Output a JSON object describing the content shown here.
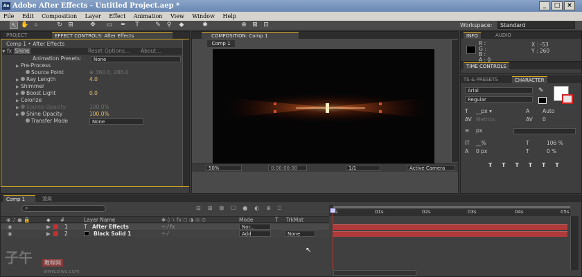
{
  "window": {
    "title": "Adobe After Effects - Untitled Project.aep *",
    "icon_text": "Ae"
  },
  "menu": [
    "File",
    "Edit",
    "Composition",
    "Layer",
    "Effect",
    "Animation",
    "View",
    "Window",
    "Help"
  ],
  "workspace": {
    "label": "Workspace:",
    "value": "Standard"
  },
  "project_panel": {
    "tab_project": "PROJECT",
    "tab_effect": "EFFECT CONTROLS: After Effects"
  },
  "effect_controls": {
    "header": "Comp 1 • After Effects",
    "effect_name": "Shine",
    "reset": "Reset",
    "options": "Options...",
    "about": "About...",
    "anim_presets_label": "Animation Presets:",
    "anim_presets_value": "None",
    "pre_process": "Pre-Process",
    "source_point": "Source Point",
    "source_point_value": "360.0, 288.0",
    "ray_length": "Ray Length",
    "ray_length_value": "4.0",
    "shimmer": "Shimmer",
    "boost_light": "Boost Light",
    "boost_light_value": "0.0",
    "colorize": "Colorize",
    "source_opacity": "Source Opacity",
    "source_opacity_value": "100.0%",
    "shine_opacity": "Shine Opacity",
    "shine_opacity_value": "100.0%",
    "transfer_mode": "Transfer Mode",
    "transfer_mode_value": "None"
  },
  "composition": {
    "tab": "COMPOSITION: Comp 1",
    "sub_tab": "Comp 1",
    "zoom": "50%",
    "timecode": "0:00:00:00",
    "resolution": "1/1",
    "camera": "Active Camera"
  },
  "info_panel": {
    "tab_info": "INFO",
    "tab_audio": "AUDIO",
    "r": "R :",
    "g": "G :",
    "b": "B :",
    "a": "A : 0",
    "x": "X : -53",
    "y": "Y : 260"
  },
  "time_controls": {
    "tab": "TIME CONTROLS"
  },
  "character_panel": {
    "tab_presets": "TS & PRESETS",
    "tab_character": "CHARACTER",
    "font": "Arial",
    "style": "Regular",
    "size_unit": "px",
    "leading": "Auto",
    "metrics": "Metrics",
    "tracking": "0",
    "stroke_unit": "px",
    "vscale": "%",
    "hscale": "106 %",
    "baseline": "0 px",
    "tsume": "0 %"
  },
  "timeline": {
    "tab_comp": "Comp 1",
    "tab_render": "渲染",
    "search_placeholder": "",
    "col_layer_name": "Layer Name",
    "col_mode": "Mode",
    "col_t": "T",
    "col_trkmat": "TrkMat",
    "ruler": [
      "0s",
      "01s",
      "02s",
      "03s",
      "04s",
      "05s"
    ],
    "layers": [
      {
        "num": "1",
        "name": "After Effects",
        "mode": "Nor...",
        "trkmat": "",
        "color": "#c03030"
      },
      {
        "num": "2",
        "name": "Black Solid 1",
        "mode": "Add",
        "trkmat": "None",
        "color": "#c03030"
      }
    ]
  },
  "watermark": {
    "logo": "子午",
    "site": "教程网",
    "url": "www.ziwu.com"
  },
  "colors": {
    "accent": "#d4a820",
    "layer_bar": "#b03a3a",
    "playhead": "#d03030"
  }
}
